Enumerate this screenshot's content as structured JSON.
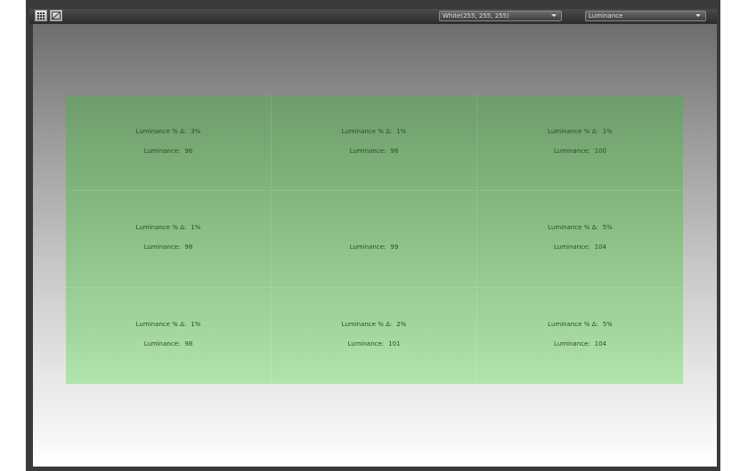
{
  "toolbar": {
    "color_select": {
      "value": "White(255, 255, 255)"
    },
    "metric_select": {
      "value": "Luminance"
    },
    "buttons": [
      {
        "name": "grid-view-button",
        "icon": "grid-icon"
      },
      {
        "name": "curve-view-button",
        "icon": "chart-curve-icon"
      }
    ]
  },
  "colors": {
    "cell_green_top": "#6d9d6a",
    "cell_green_bottom": "#b1e3ad",
    "text": "#2d4a2b"
  },
  "cells": [
    {
      "delta_label": "Luminance % Δ:",
      "delta": "3%",
      "lum_label": "Luminance:",
      "lum": "96"
    },
    {
      "delta_label": "Luminance % Δ:",
      "delta": "1%",
      "lum_label": "Luminance:",
      "lum": "98"
    },
    {
      "delta_label": "Luminance % Δ:",
      "delta": "1%",
      "lum_label": "Luminance:",
      "lum": "100"
    },
    {
      "delta_label": "Luminance % Δ:",
      "delta": "1%",
      "lum_label": "Luminance:",
      "lum": "98"
    },
    {
      "delta_label": "",
      "delta": "",
      "lum_label": "Luminance:",
      "lum": "99"
    },
    {
      "delta_label": "Luminance % Δ:",
      "delta": "5%",
      "lum_label": "Luminance:",
      "lum": "104"
    },
    {
      "delta_label": "Luminance % Δ:",
      "delta": "1%",
      "lum_label": "Luminance:",
      "lum": "98"
    },
    {
      "delta_label": "Luminance % Δ:",
      "delta": "2%",
      "lum_label": "Luminance:",
      "lum": "101"
    },
    {
      "delta_label": "Luminance % Δ:",
      "delta": "5%",
      "lum_label": "Luminance:",
      "lum": "104"
    }
  ]
}
